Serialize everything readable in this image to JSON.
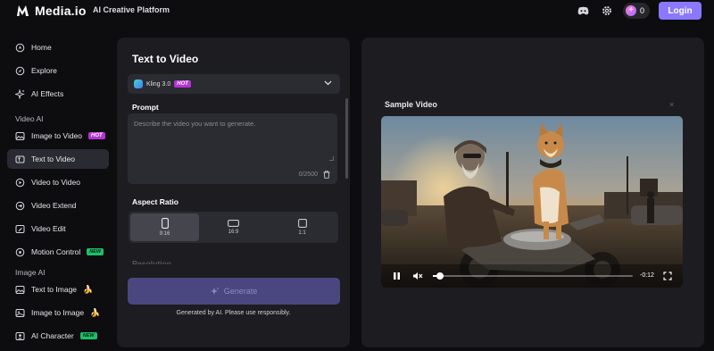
{
  "header": {
    "brand": "Media.io",
    "platform": "AI Creative Platform",
    "credits": "0",
    "login_label": "Login"
  },
  "sidebar": {
    "items": [
      {
        "label": "Home",
        "icon": "home-icon"
      },
      {
        "label": "Explore",
        "icon": "compass-icon"
      },
      {
        "label": "AI Effects",
        "icon": "sparkles-icon"
      }
    ],
    "video_section": "Video AI",
    "video_items": [
      {
        "label": "Image to Video",
        "icon": "image-video-icon",
        "badge": "HOT"
      },
      {
        "label": "Text to Video",
        "icon": "text-video-icon",
        "active": true
      },
      {
        "label": "Video to Video",
        "icon": "video-loop-icon"
      },
      {
        "label": "Video Extend",
        "icon": "extend-icon"
      },
      {
        "label": "Video Edit",
        "icon": "edit-icon"
      },
      {
        "label": "Motion Control",
        "icon": "motion-icon",
        "badge": "NEW"
      }
    ],
    "image_section": "Image AI",
    "image_items": [
      {
        "label": "Text to Image",
        "icon": "text-image-icon",
        "emoji": "🍌"
      },
      {
        "label": "Image to Image",
        "icon": "image-image-icon",
        "emoji": "🍌"
      },
      {
        "label": "AI Character",
        "icon": "character-icon",
        "badge": "NEW"
      }
    ]
  },
  "form": {
    "title": "Text to Video",
    "model": "Kling 3.0",
    "model_badge": "HOT",
    "prompt_label": "Prompt",
    "prompt_placeholder": "Describe the video you want to generate.",
    "counter": "0/2500",
    "aspect_label": "Aspect Ratio",
    "ratios": [
      "9:16",
      "16:9",
      "1:1"
    ],
    "selected_ratio": "9:16",
    "resolution_label": "Resolution",
    "generate_label": "Generate",
    "disclaimer": "Generated by AI. Please use responsibly."
  },
  "preview": {
    "title": "Sample Video",
    "close": "×",
    "time": "-0:12",
    "progress": 0.02
  },
  "colors": {
    "accent": "#8a78ff",
    "hot": "#b633d6",
    "new": "#1fbf6a"
  }
}
